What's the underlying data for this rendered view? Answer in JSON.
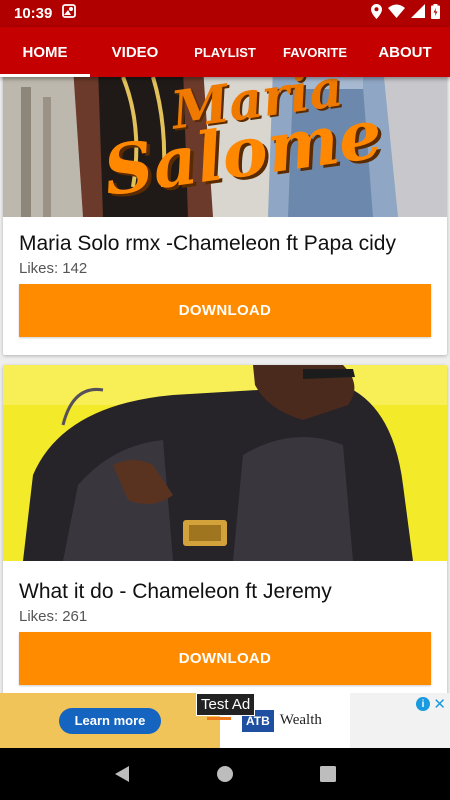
{
  "status_bar": {
    "time": "10:39"
  },
  "tabs": [
    {
      "label": "HOME",
      "selected": true
    },
    {
      "label": "VIDEO",
      "selected": false
    },
    {
      "label": "PLAYLIST",
      "selected": false
    },
    {
      "label": "FAVORITE",
      "selected": false
    },
    {
      "label": "ABOUT",
      "selected": false
    }
  ],
  "colors": {
    "status_bar": "#b00000",
    "tab_bar": "#c40000",
    "download_button": "#ff8c00",
    "ad_button": "#1564c0"
  },
  "cards": [
    {
      "cover_text_1": "Maria",
      "cover_text_2": "Salome",
      "title": "Maria Solo rmx -Chameleon ft Papa cidy",
      "likes_label": "Likes:",
      "likes_value": "142",
      "button_label": "DOWNLOAD"
    },
    {
      "title": "What it do - Chameleon ft Jeremy",
      "likes_label": "Likes:",
      "likes_value": "261",
      "button_label": "DOWNLOAD"
    }
  ],
  "ad": {
    "tag": "Test Ad",
    "cta": "Learn more",
    "brand": "ATB",
    "brand_text": "Wealth",
    "choices_icon": "info-icon",
    "close_icon": "close-icon"
  },
  "nav_bar": {
    "icons": [
      "back-icon",
      "home-icon",
      "recents-icon"
    ]
  }
}
